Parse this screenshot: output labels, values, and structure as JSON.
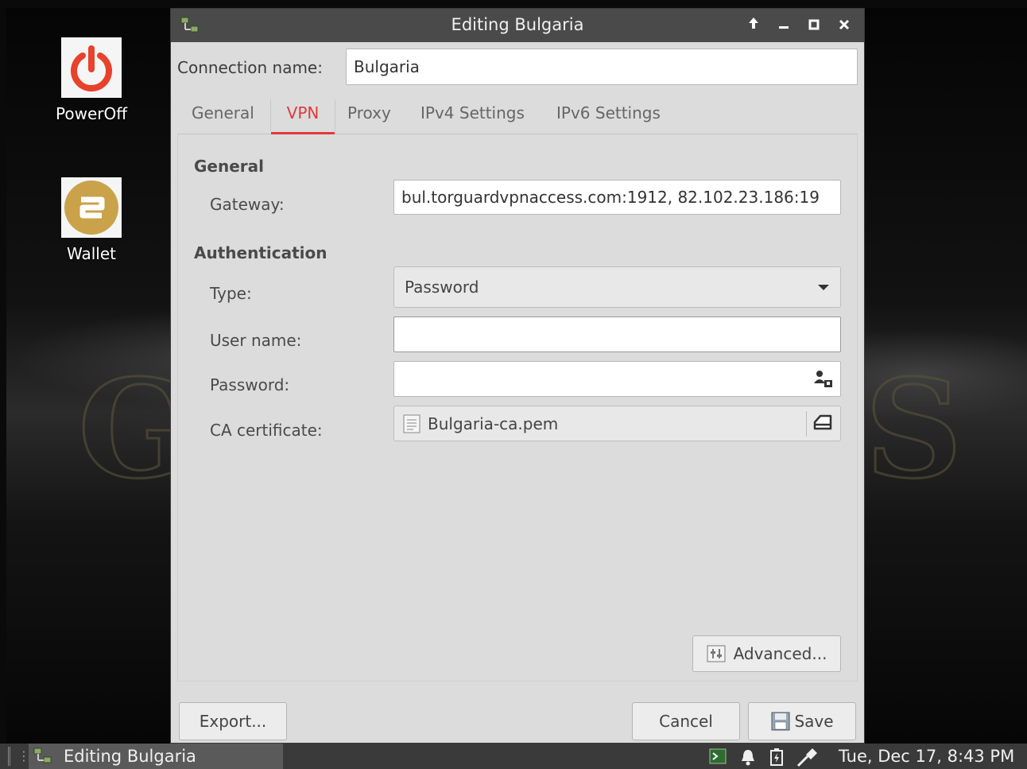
{
  "desktop": {
    "icons": [
      {
        "label": "PowerOff",
        "icon": "power-icon",
        "color": "#e8412c"
      },
      {
        "label": "Wallet",
        "icon": "wallet-coin-icon",
        "color": "#c9a24a"
      }
    ]
  },
  "dialog": {
    "title": "Editing Bulgaria",
    "title_controls": [
      "keep-above-icon",
      "minimize-icon",
      "maximize-icon",
      "close-icon"
    ],
    "connection_name_label": "Connection name:",
    "connection_name_value": "Bulgaria",
    "tabs": [
      {
        "label": "General",
        "active": false
      },
      {
        "label": "VPN",
        "active": true
      },
      {
        "label": "Proxy",
        "active": false
      },
      {
        "label": "IPv4 Settings",
        "active": false
      },
      {
        "label": "IPv6 Settings",
        "active": false
      }
    ],
    "vpn": {
      "general_heading": "General",
      "gateway_label": "Gateway:",
      "gateway_value": "bul.torguardvpnaccess.com:1912, 82.102.23.186:19",
      "auth_heading": "Authentication",
      "type_label": "Type:",
      "type_value": "Password",
      "username_label": "User name:",
      "username_value": "",
      "password_label": "Password:",
      "password_value": "",
      "password_icon": "user-lock-icon",
      "ca_label": "CA certificate:",
      "ca_value": "Bulgaria-ca.pem",
      "ca_file_icon": "file-icon",
      "ca_clear_icon": "clear-icon",
      "advanced_label": "Advanced..."
    },
    "buttons": {
      "export": "Export...",
      "cancel": "Cancel",
      "save": "Save"
    },
    "accent_color": "#e03a3a"
  },
  "taskbar": {
    "task_label": "Editing Bulgaria",
    "clock": "Tue, Dec 17,  8:43 PM",
    "tray_icons": [
      "terminal-icon",
      "bell-icon",
      "battery-icon",
      "network-icon"
    ]
  }
}
